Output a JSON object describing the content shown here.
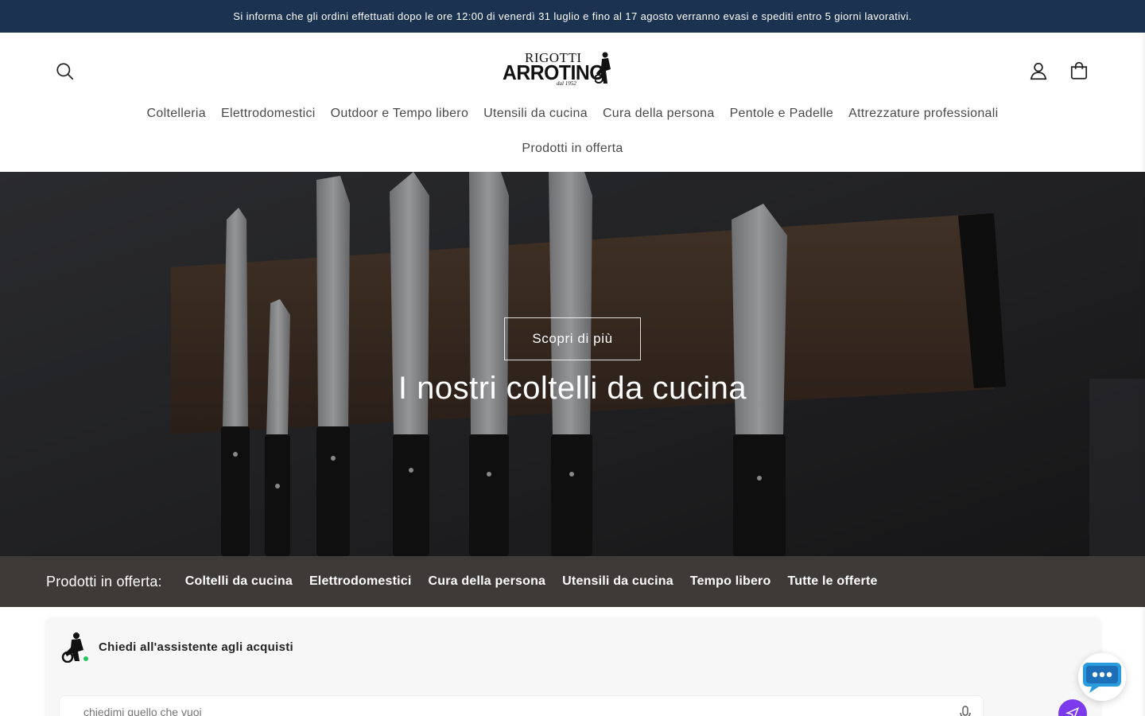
{
  "announcement": "Si informa che gli ordini effettuati dopo le ore 12:00 di venerdì 31 luglio e fino al 17 agosto verranno evasi e spediti entro 5 giorni lavorativi.",
  "logo": {
    "top": "RIGOTTI",
    "main": "ARROTINO",
    "sub": "dal 1952"
  },
  "nav": {
    "items": [
      "Coltelleria",
      "Elettrodomestici",
      "Outdoor e Tempo libero",
      "Utensili da cucina",
      "Cura della persona",
      "Pentole e Padelle",
      "Attrezzature professionali"
    ],
    "second_row": "Prodotti in offerta"
  },
  "hero": {
    "cta": "Scopri di più",
    "title": "I nostri coltelli da cucina"
  },
  "offers": {
    "label": "Prodotti in offerta:",
    "links": [
      "Coltelli da cucina",
      "Elettrodomestici",
      "Cura della persona",
      "Utensili da cucina",
      "Tempo libero",
      "Tutte le offerte"
    ]
  },
  "assistant": {
    "title": "Chiedi all'assistente agli acquisti",
    "placeholder": "chiedimi quello che vuoi"
  },
  "icons": {
    "search": "search-icon",
    "account": "user-icon",
    "cart": "shopping-bag-icon",
    "mic": "microphone-icon",
    "send": "send-icon",
    "chat": "chat-bubble-icon"
  },
  "colors": {
    "announcement_bg": "#1b3350",
    "offers_bg": "#3e3a37",
    "send_button": "#7c3aed",
    "online_dot": "#22c55e"
  }
}
